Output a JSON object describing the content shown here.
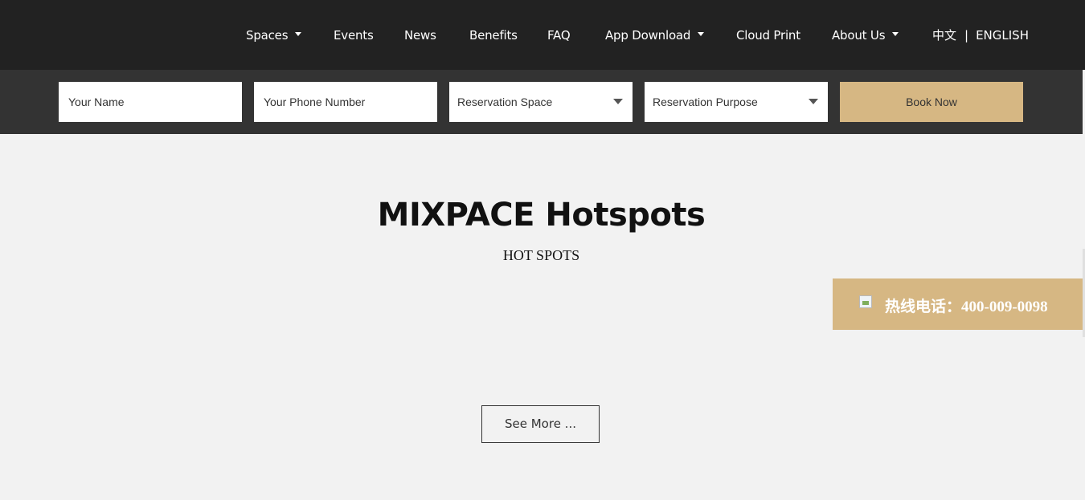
{
  "nav": {
    "items": [
      {
        "label": "Spaces",
        "dropdown": true
      },
      {
        "label": "Events",
        "dropdown": false
      },
      {
        "label": "News",
        "dropdown": false
      },
      {
        "label": "Benefits",
        "dropdown": false
      },
      {
        "label": "FAQ",
        "dropdown": false
      },
      {
        "label": "App Download",
        "dropdown": true
      },
      {
        "label": "Cloud Print",
        "dropdown": false
      },
      {
        "label": "About Us",
        "dropdown": true
      }
    ],
    "lang_cn": "中文",
    "lang_sep": "|",
    "lang_en": "ENGLISH"
  },
  "booking": {
    "name_placeholder": "Your Name",
    "phone_placeholder": "Your Phone Number",
    "space_selected": "Reservation Space",
    "purpose_selected": "Reservation Purpose",
    "book_label": "Book Now"
  },
  "hotspots": {
    "title": "MIXPACE Hotspots",
    "subtitle": "HOT SPOTS",
    "see_more": "See More ..."
  },
  "hotline": {
    "text": "热线电话：400-009-0098"
  },
  "colors": {
    "nav_bg": "#222222",
    "bookbar_bg": "#333333",
    "accent": "#d6b783",
    "page_bg": "#f2f2f2"
  }
}
